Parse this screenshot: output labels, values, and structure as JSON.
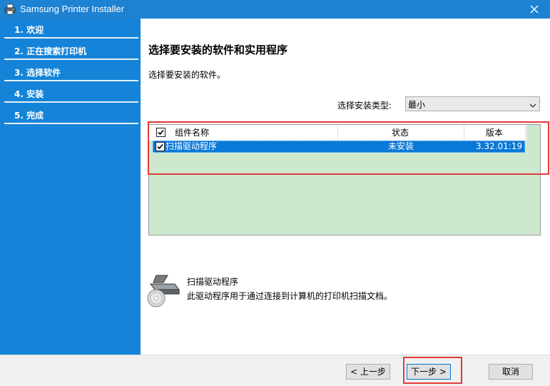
{
  "window": {
    "title": "Samsung Printer Installer",
    "close_glyph": "✕",
    "accent_color": "#1e82d2",
    "sidebar_color": "#1584d8"
  },
  "sidebar": {
    "steps": [
      {
        "label": "1. 欢迎"
      },
      {
        "label": "2. 正在搜索打印机"
      },
      {
        "label": "3. 选择软件"
      },
      {
        "label": "4. 安装"
      },
      {
        "label": "5. 完成"
      }
    ]
  },
  "content": {
    "heading": "选择要安装的软件和实用程序",
    "subtext": "选择要安装的软件。",
    "install_type": {
      "label": "选择安装类型:",
      "selected": "最小"
    },
    "list": {
      "columns": [
        "组件名称",
        "状态",
        "版本"
      ],
      "rows": [
        {
          "name": "扫描驱动程序",
          "status": "未安装",
          "version": "3.32.01:19",
          "checked": true,
          "selected": true
        }
      ],
      "background_color": "#cde8cd",
      "selected_row_color": "#0a78d6"
    },
    "description": {
      "icon": "scanner-icon",
      "title": "扫描驱动程序",
      "text": "此驱动程序用于通过连接到计算机的打印机扫描文档。"
    }
  },
  "footer": {
    "back_label": "< 上一步",
    "next_label": "下一步 >",
    "cancel_label": "取消"
  }
}
